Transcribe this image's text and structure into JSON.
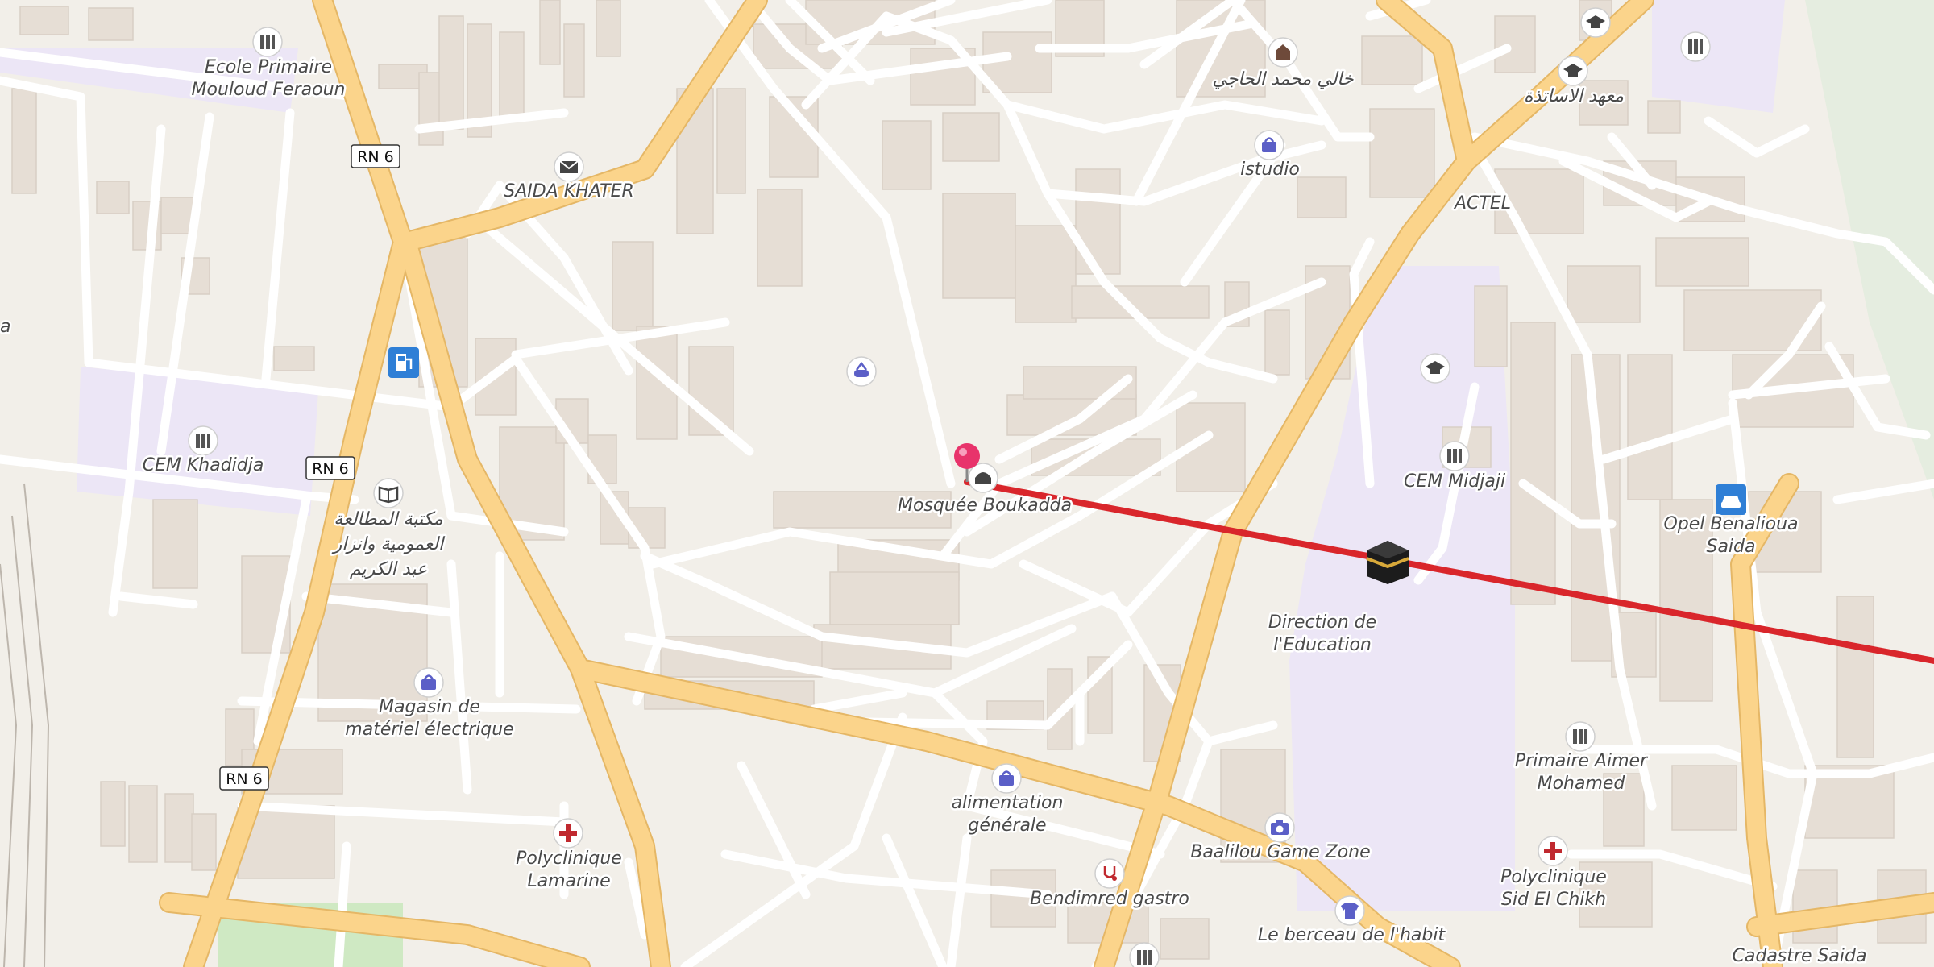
{
  "map": {
    "route_color": "#d9262b",
    "pin_color": "#e8336b",
    "road_refs": [
      "RN 6",
      "RN 6",
      "RN 6"
    ],
    "pois": [
      {
        "name": "Ecole Primaire Mouloud Feraoun",
        "lines": [
          "Ecole Primaire",
          "Mouloud Feraoun"
        ],
        "icon": "school-icon"
      },
      {
        "name": "SAIDA KHATER",
        "lines": [
          "SAIDA KHATER"
        ],
        "icon": "mail-icon"
      },
      {
        "name": "خالي محمد الحاجي",
        "lines": [
          "خالي محمد الحاجي"
        ],
        "icon": "shop-icon"
      },
      {
        "name": "istudio",
        "lines": [
          "istudio"
        ],
        "icon": "shopping-bag-icon"
      },
      {
        "name": "معهد الاساتذة",
        "lines": [
          "معهد الاساتذة"
        ],
        "icon": "graduation-cap-icon"
      },
      {
        "name": "ACTEL",
        "lines": [
          "ACTEL"
        ],
        "icon": ""
      },
      {
        "name": "CEM Khadidja",
        "lines": [
          "CEM Khadidja"
        ],
        "icon": "school-icon"
      },
      {
        "name": "مكتبة المطالعة العمومية وانزار عبد الكريم",
        "lines": [
          "مكتبة المطالعة",
          "العمومية وانزار",
          "عبد الكريم"
        ],
        "icon": "book-icon"
      },
      {
        "name": "Mosquée Boukadda",
        "lines": [
          "Mosquée Boukadda"
        ],
        "icon": "mosque-icon"
      },
      {
        "name": "CEM Midjaji",
        "lines": [
          "CEM Midjaji"
        ],
        "icon": "school-icon"
      },
      {
        "name": "Opel Benalioua Saida",
        "lines": [
          "Opel Benalioua",
          "Saida"
        ],
        "icon": "car-icon"
      },
      {
        "name": "Direction de l'Education",
        "lines": [
          "Direction de",
          "l'Education"
        ],
        "icon": ""
      },
      {
        "name": "Magasin de matériel électrique",
        "lines": [
          "Magasin de",
          "matériel électrique"
        ],
        "icon": "shopping-bag-icon"
      },
      {
        "name": "alimentation générale",
        "lines": [
          "alimentation",
          "générale"
        ],
        "icon": "shopping-bag-icon"
      },
      {
        "name": "Primaire Aimer Mohamed",
        "lines": [
          "Primaire Aimer",
          "Mohamed"
        ],
        "icon": "school-icon"
      },
      {
        "name": "Polyclinique Lamarine",
        "lines": [
          "Polyclinique",
          "Lamarine"
        ],
        "icon": "medical-cross-icon"
      },
      {
        "name": "Baalilou Game Zone",
        "lines": [
          "Baalilou Game Zone"
        ],
        "icon": "camera-icon"
      },
      {
        "name": "Bendimred gastro",
        "lines": [
          "Bendimred gastro"
        ],
        "icon": "doctor-icon"
      },
      {
        "name": "Polyclinique Sid El Chikh",
        "lines": [
          "Polyclinique",
          "Sid El Chikh"
        ],
        "icon": "medical-cross-icon"
      },
      {
        "name": "Le berceau de l'habit",
        "lines": [
          "Le berceau de l'habit"
        ],
        "icon": "clothes-icon"
      },
      {
        "name": "Cadastre Saida",
        "lines": [
          "Cadastre Saida"
        ],
        "icon": ""
      },
      {
        "name": "a",
        "lines": [
          "a"
        ],
        "icon": ""
      }
    ],
    "extra_icons": [
      "fuel-icon",
      "playground-icon",
      "kaaba-icon",
      "school-icon"
    ]
  }
}
